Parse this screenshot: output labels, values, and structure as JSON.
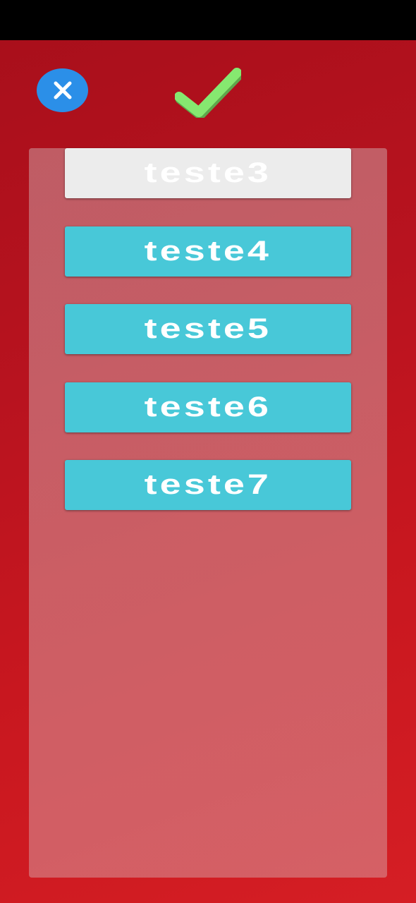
{
  "icons": {
    "close": "close-icon",
    "confirm": "checkmark-icon",
    "back": "chevron-left-icon"
  },
  "colors": {
    "background": "#c0141f",
    "close_button": "#2b8fe8",
    "checkmark": "#7ee06a",
    "option_selected": "#ececec",
    "option_normal": "#48c8d8"
  },
  "options": [
    {
      "label": "teste3",
      "selected": true
    },
    {
      "label": "teste4",
      "selected": false
    },
    {
      "label": "teste5",
      "selected": false
    },
    {
      "label": "teste6",
      "selected": false
    },
    {
      "label": "teste7",
      "selected": false
    }
  ]
}
